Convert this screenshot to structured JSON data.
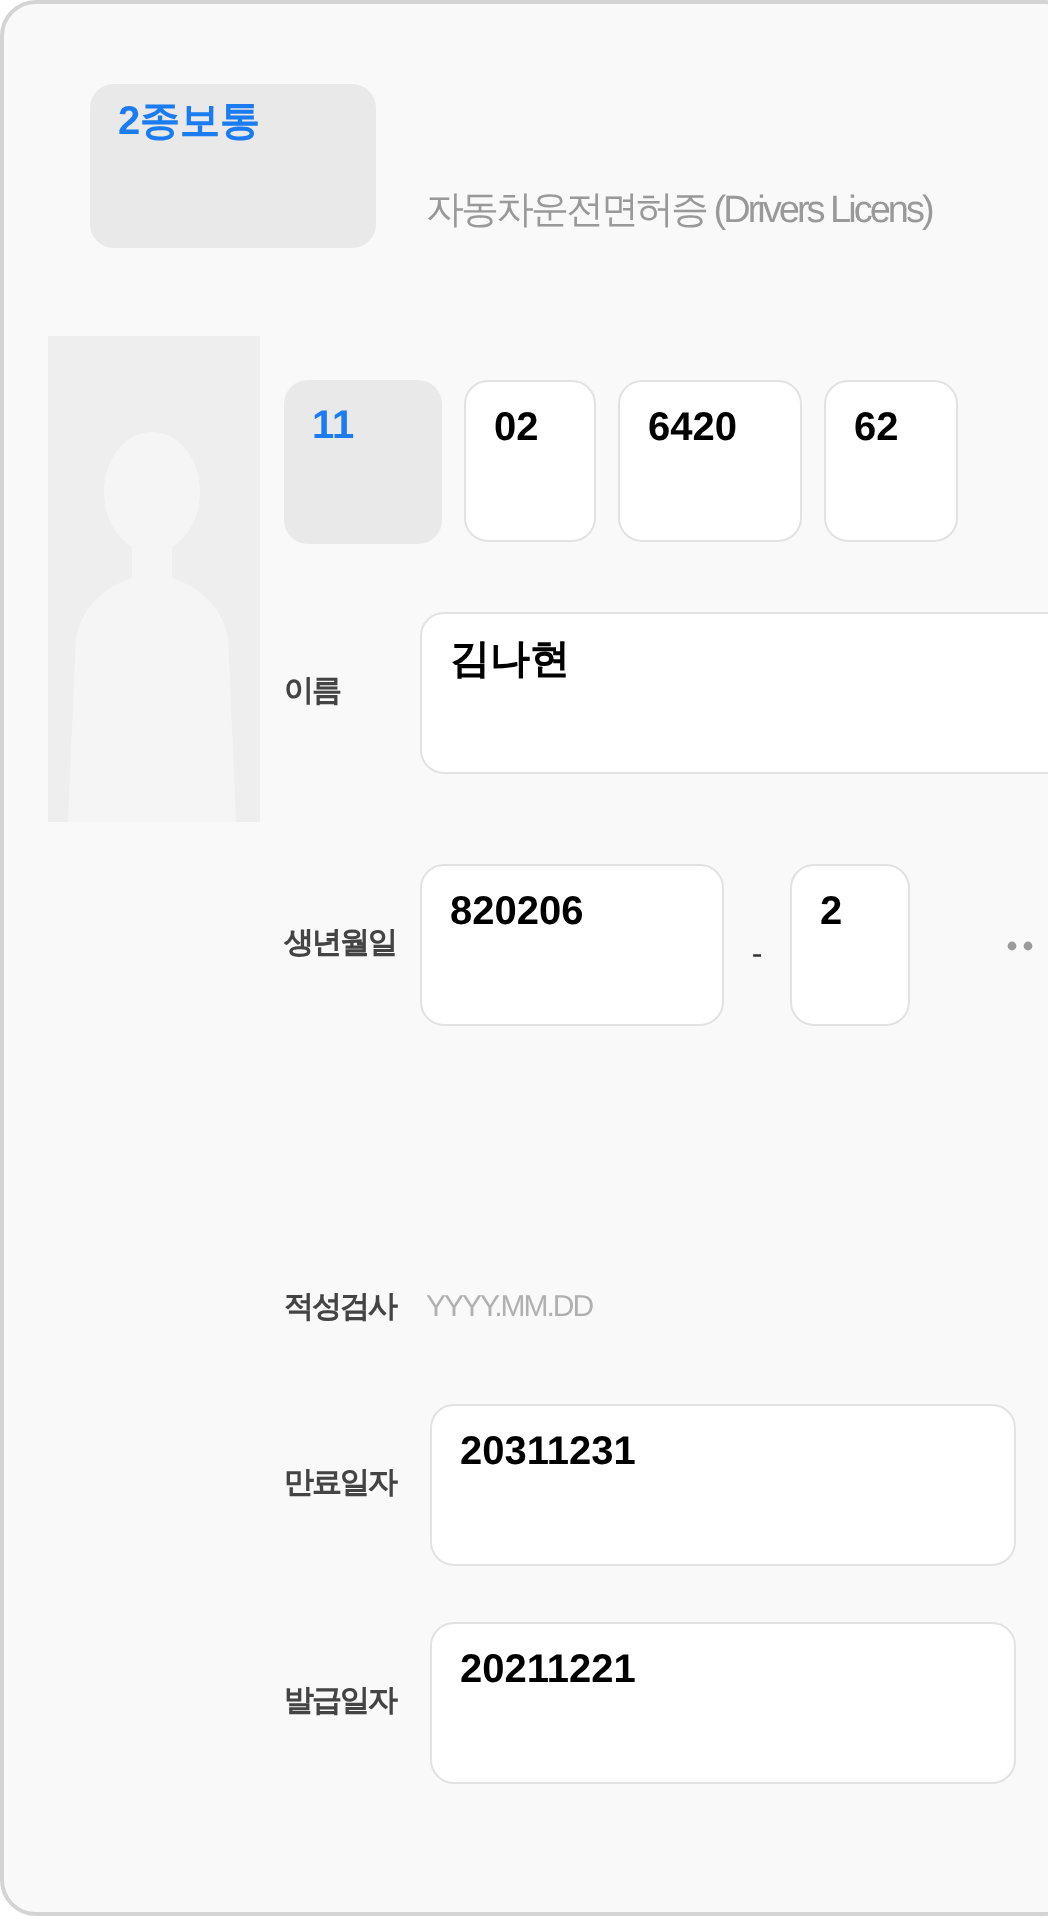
{
  "license_type": "2종보통",
  "title": "자동차운전면허증 (Drivers Licens)",
  "license_number": [
    {
      "kind": "select",
      "value": "11"
    },
    {
      "kind": "input",
      "value": "02"
    },
    {
      "kind": "input",
      "value": "6420"
    },
    {
      "kind": "input",
      "value": "62"
    }
  ],
  "fields": [
    {
      "kind": "text",
      "label": "이름",
      "value": "김나현"
    },
    {
      "kind": "resident",
      "label": "생년월일",
      "value": "820206",
      "separator": "-",
      "value_2": "2"
    },
    {
      "kind": "placeholder",
      "label": "적성검사",
      "placeholder": "YYYY.MM.DD"
    },
    {
      "kind": "date",
      "label": "만료일자",
      "value": "20311231"
    },
    {
      "kind": "date",
      "label": "발급일자",
      "value": "20211221"
    }
  ]
}
